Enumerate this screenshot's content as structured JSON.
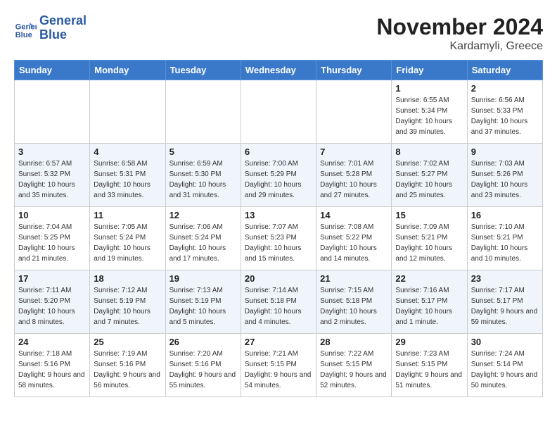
{
  "header": {
    "logo_line1": "General",
    "logo_line2": "Blue",
    "month": "November 2024",
    "location": "Kardamyli, Greece"
  },
  "weekdays": [
    "Sunday",
    "Monday",
    "Tuesday",
    "Wednesday",
    "Thursday",
    "Friday",
    "Saturday"
  ],
  "weeks": [
    [
      {
        "day": "",
        "info": ""
      },
      {
        "day": "",
        "info": ""
      },
      {
        "day": "",
        "info": ""
      },
      {
        "day": "",
        "info": ""
      },
      {
        "day": "",
        "info": ""
      },
      {
        "day": "1",
        "info": "Sunrise: 6:55 AM\nSunset: 5:34 PM\nDaylight: 10 hours and 39 minutes."
      },
      {
        "day": "2",
        "info": "Sunrise: 6:56 AM\nSunset: 5:33 PM\nDaylight: 10 hours and 37 minutes."
      }
    ],
    [
      {
        "day": "3",
        "info": "Sunrise: 6:57 AM\nSunset: 5:32 PM\nDaylight: 10 hours and 35 minutes."
      },
      {
        "day": "4",
        "info": "Sunrise: 6:58 AM\nSunset: 5:31 PM\nDaylight: 10 hours and 33 minutes."
      },
      {
        "day": "5",
        "info": "Sunrise: 6:59 AM\nSunset: 5:30 PM\nDaylight: 10 hours and 31 minutes."
      },
      {
        "day": "6",
        "info": "Sunrise: 7:00 AM\nSunset: 5:29 PM\nDaylight: 10 hours and 29 minutes."
      },
      {
        "day": "7",
        "info": "Sunrise: 7:01 AM\nSunset: 5:28 PM\nDaylight: 10 hours and 27 minutes."
      },
      {
        "day": "8",
        "info": "Sunrise: 7:02 AM\nSunset: 5:27 PM\nDaylight: 10 hours and 25 minutes."
      },
      {
        "day": "9",
        "info": "Sunrise: 7:03 AM\nSunset: 5:26 PM\nDaylight: 10 hours and 23 minutes."
      }
    ],
    [
      {
        "day": "10",
        "info": "Sunrise: 7:04 AM\nSunset: 5:25 PM\nDaylight: 10 hours and 21 minutes."
      },
      {
        "day": "11",
        "info": "Sunrise: 7:05 AM\nSunset: 5:24 PM\nDaylight: 10 hours and 19 minutes."
      },
      {
        "day": "12",
        "info": "Sunrise: 7:06 AM\nSunset: 5:24 PM\nDaylight: 10 hours and 17 minutes."
      },
      {
        "day": "13",
        "info": "Sunrise: 7:07 AM\nSunset: 5:23 PM\nDaylight: 10 hours and 15 minutes."
      },
      {
        "day": "14",
        "info": "Sunrise: 7:08 AM\nSunset: 5:22 PM\nDaylight: 10 hours and 14 minutes."
      },
      {
        "day": "15",
        "info": "Sunrise: 7:09 AM\nSunset: 5:21 PM\nDaylight: 10 hours and 12 minutes."
      },
      {
        "day": "16",
        "info": "Sunrise: 7:10 AM\nSunset: 5:21 PM\nDaylight: 10 hours and 10 minutes."
      }
    ],
    [
      {
        "day": "17",
        "info": "Sunrise: 7:11 AM\nSunset: 5:20 PM\nDaylight: 10 hours and 8 minutes."
      },
      {
        "day": "18",
        "info": "Sunrise: 7:12 AM\nSunset: 5:19 PM\nDaylight: 10 hours and 7 minutes."
      },
      {
        "day": "19",
        "info": "Sunrise: 7:13 AM\nSunset: 5:19 PM\nDaylight: 10 hours and 5 minutes."
      },
      {
        "day": "20",
        "info": "Sunrise: 7:14 AM\nSunset: 5:18 PM\nDaylight: 10 hours and 4 minutes."
      },
      {
        "day": "21",
        "info": "Sunrise: 7:15 AM\nSunset: 5:18 PM\nDaylight: 10 hours and 2 minutes."
      },
      {
        "day": "22",
        "info": "Sunrise: 7:16 AM\nSunset: 5:17 PM\nDaylight: 10 hours and 1 minute."
      },
      {
        "day": "23",
        "info": "Sunrise: 7:17 AM\nSunset: 5:17 PM\nDaylight: 9 hours and 59 minutes."
      }
    ],
    [
      {
        "day": "24",
        "info": "Sunrise: 7:18 AM\nSunset: 5:16 PM\nDaylight: 9 hours and 58 minutes."
      },
      {
        "day": "25",
        "info": "Sunrise: 7:19 AM\nSunset: 5:16 PM\nDaylight: 9 hours and 56 minutes."
      },
      {
        "day": "26",
        "info": "Sunrise: 7:20 AM\nSunset: 5:16 PM\nDaylight: 9 hours and 55 minutes."
      },
      {
        "day": "27",
        "info": "Sunrise: 7:21 AM\nSunset: 5:15 PM\nDaylight: 9 hours and 54 minutes."
      },
      {
        "day": "28",
        "info": "Sunrise: 7:22 AM\nSunset: 5:15 PM\nDaylight: 9 hours and 52 minutes."
      },
      {
        "day": "29",
        "info": "Sunrise: 7:23 AM\nSunset: 5:15 PM\nDaylight: 9 hours and 51 minutes."
      },
      {
        "day": "30",
        "info": "Sunrise: 7:24 AM\nSunset: 5:14 PM\nDaylight: 9 hours and 50 minutes."
      }
    ]
  ]
}
